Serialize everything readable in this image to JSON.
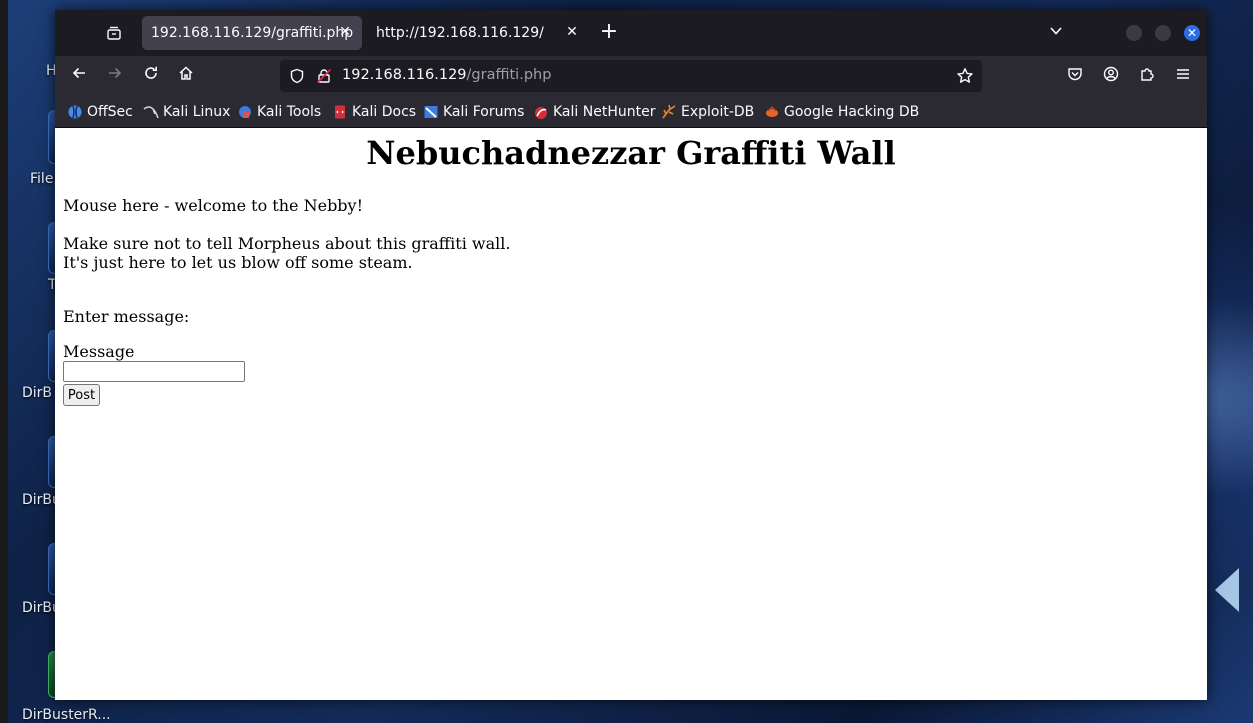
{
  "desktop": {
    "icons": [
      {
        "label": "H"
      },
      {
        "label": "File"
      },
      {
        "label": "T"
      },
      {
        "label": "DirB"
      },
      {
        "label": "DirBu"
      },
      {
        "label": "DirBu"
      },
      {
        "label": "DirBusterR..."
      }
    ]
  },
  "browser": {
    "tabs": [
      {
        "title": "192.168.116.129/graffiti.php",
        "active": true
      },
      {
        "title": "http://192.168.116.129/",
        "active": false
      }
    ],
    "url": {
      "host": "192.168.116.129",
      "path": "/graffiti.php"
    },
    "bookmarks": [
      {
        "label": "OffSec",
        "icon": "offsec-icon",
        "color": "#3f8ef5"
      },
      {
        "label": "Kali Linux",
        "icon": "kali-dragon-icon",
        "color": "#d8d8d8"
      },
      {
        "label": "Kali Tools",
        "icon": "kali-tools-icon",
        "color": "#3b7ddd"
      },
      {
        "label": "Kali Docs",
        "icon": "kali-docs-icon",
        "color": "#d0303a"
      },
      {
        "label": "Kali Forums",
        "icon": "kali-forums-icon",
        "color": "#3b7ddd"
      },
      {
        "label": "Kali NetHunter",
        "icon": "nethunter-icon",
        "color": "#d0303a"
      },
      {
        "label": "Exploit-DB",
        "icon": "exploitdb-icon",
        "color": "#e58a2a"
      },
      {
        "label": "Google Hacking DB",
        "icon": "ghdb-icon",
        "color": "#e5652a"
      }
    ]
  },
  "page": {
    "title": "Nebuchadnezzar Graffiti Wall",
    "welcome": "Mouse here - welcome to the Nebby!",
    "line1": "Make sure not to tell Morpheus about this graffiti wall.",
    "line2": "It's just here to let us blow off some steam.",
    "enter_label": "Enter message:",
    "message_label": "Message",
    "message_value": "",
    "post_label": "Post"
  }
}
